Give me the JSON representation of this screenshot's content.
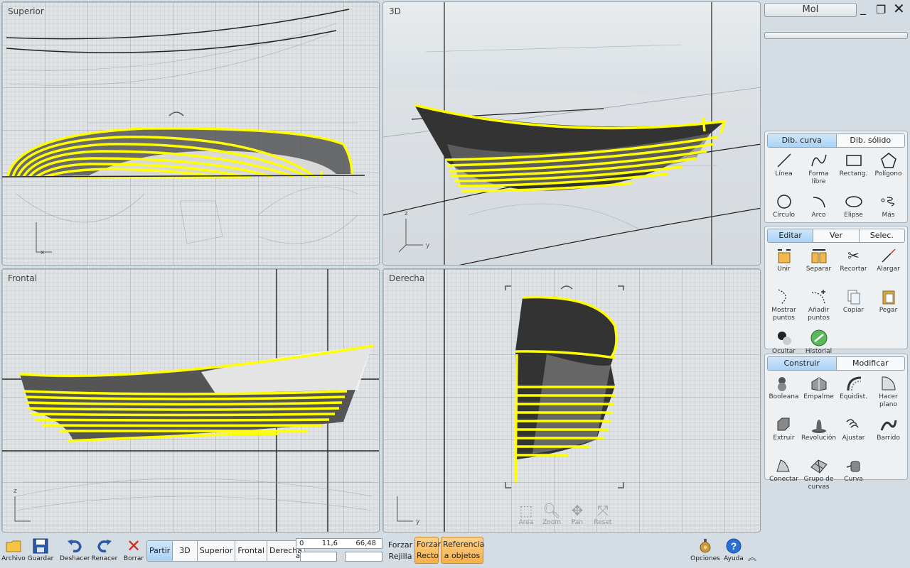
{
  "app": {
    "title": "MoI"
  },
  "viewports": {
    "top": {
      "label": "Superior"
    },
    "persp": {
      "label": "3D"
    },
    "front": {
      "label": "Frontal"
    },
    "right": {
      "label": "Derecha"
    },
    "nav_tools": [
      "Area",
      "Zoom",
      "Pan",
      "Reset"
    ]
  },
  "draw_group": {
    "tabs": [
      "Dib. curva",
      "Dib. sólido"
    ],
    "tools": [
      {
        "label": "Línea",
        "icon": "line-icon"
      },
      {
        "label": "Forma libre",
        "icon": "freeform-icon"
      },
      {
        "label": "Rectang.",
        "icon": "rectangle-icon"
      },
      {
        "label": "Polígono",
        "icon": "polygon-icon"
      },
      {
        "label": "Círculo",
        "icon": "circle-icon"
      },
      {
        "label": "Arco",
        "icon": "arc-icon"
      },
      {
        "label": "Elipse",
        "icon": "ellipse-icon"
      },
      {
        "label": "Más",
        "icon": "more-icon"
      }
    ]
  },
  "edit_group": {
    "tabs": [
      "Editar",
      "Ver",
      "Selec."
    ],
    "tools": [
      {
        "label": "Unir",
        "icon": "join-icon"
      },
      {
        "label": "Separar",
        "icon": "separate-icon"
      },
      {
        "label": "Recortar",
        "icon": "trim-icon"
      },
      {
        "label": "Alargar",
        "icon": "extend-icon"
      },
      {
        "label": "Mostrar puntos",
        "icon": "show-points-icon"
      },
      {
        "label": "Añadir puntos",
        "icon": "add-points-icon"
      },
      {
        "label": "Copiar",
        "icon": "copy-icon"
      },
      {
        "label": "Pegar",
        "icon": "paste-icon"
      },
      {
        "label": "Ocultar",
        "icon": "hide-icon"
      },
      {
        "label": "Historial",
        "icon": "history-icon"
      }
    ]
  },
  "construct_group": {
    "tabs": [
      "Construir",
      "Modificar"
    ],
    "tools": [
      {
        "label": "Booleana",
        "icon": "boolean-icon"
      },
      {
        "label": "Empalme",
        "icon": "fillet-icon"
      },
      {
        "label": "Equidist.",
        "icon": "offset-icon"
      },
      {
        "label": "Hacer plano",
        "icon": "planar-icon"
      },
      {
        "label": "Extruir",
        "icon": "extrude-icon"
      },
      {
        "label": "Revolución",
        "icon": "revolve-icon"
      },
      {
        "label": "Ajustar",
        "icon": "loft-icon"
      },
      {
        "label": "Barrido",
        "icon": "sweep-icon"
      },
      {
        "label": "Conectar",
        "icon": "blend-icon"
      },
      {
        "label": "Grupo de curvas",
        "icon": "network-icon"
      },
      {
        "label": "Curva",
        "icon": "curve-icon"
      }
    ]
  },
  "bottom": {
    "file_buttons": {
      "open": "Archivo",
      "save": "Guardar",
      "undo": "Deshacer",
      "redo": "Renacer",
      "delete": "Borrar"
    },
    "view_buttons": [
      "Partir",
      "3D",
      "Superior",
      "Frontal",
      "Derecha"
    ],
    "active_view": "Partir",
    "coords": {
      "x": "0",
      "y": "11,6",
      "z": "66,48"
    },
    "grid_snap": "Forzar Rejilla",
    "straight_snap": [
      "Forzar",
      "Recto"
    ],
    "object_snap": [
      "Referencia",
      "a objetos"
    ],
    "options": "Opciones",
    "help": "Ayuda"
  },
  "colors": {
    "highlight_curve": "#ffff00",
    "active_tab": "#a9d2f5",
    "snap_on": "#f6b14a"
  }
}
